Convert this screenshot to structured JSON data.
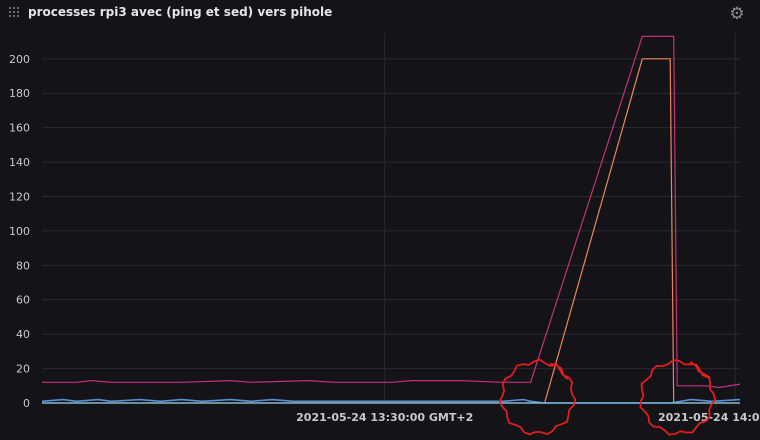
{
  "panel": {
    "title": "processes rpi3 avec (ping et sed) vers pihole",
    "settings_icon": "gear-icon",
    "drag_icon": "drag-handle-icon"
  },
  "colors": {
    "background": "#141318",
    "grid": "#2a2a31",
    "series_1": "#c2327a",
    "series_2": "#e8875a",
    "series_3": "#5b8fd6",
    "series_4": "#7ec8e3",
    "annotation": "#e01e1e"
  },
  "chart_data": {
    "type": "line",
    "title": "processes rpi3 avec (ping et sed) vers pihole",
    "xlabel": "",
    "ylabel": "",
    "ylim": [
      0,
      215
    ],
    "y_ticks": [
      0,
      20,
      40,
      60,
      80,
      100,
      120,
      140,
      160,
      180,
      200
    ],
    "x_tick_labels": [
      "2021-05-24 13:30:00 GMT+2",
      "2021-05-24 14:0"
    ],
    "grid": true,
    "legend": "none",
    "series": [
      {
        "color": "#c2327a",
        "points": [
          [
            0.0,
            12
          ],
          [
            0.05,
            12
          ],
          [
            0.07,
            13
          ],
          [
            0.1,
            12
          ],
          [
            0.2,
            12
          ],
          [
            0.27,
            13
          ],
          [
            0.3,
            12
          ],
          [
            0.38,
            13
          ],
          [
            0.42,
            12
          ],
          [
            0.5,
            12
          ],
          [
            0.53,
            13
          ],
          [
            0.6,
            13
          ],
          [
            0.66,
            12
          ],
          [
            0.68,
            12
          ],
          [
            0.7,
            12
          ],
          [
            0.86,
            213
          ],
          [
            0.905,
            213
          ],
          [
            0.91,
            10
          ],
          [
            0.95,
            10
          ],
          [
            0.97,
            9
          ],
          [
            1.0,
            11
          ]
        ]
      },
      {
        "color": "#e8875a",
        "points": [
          [
            0.0,
            0
          ],
          [
            0.72,
            0
          ],
          [
            0.86,
            200
          ],
          [
            0.9,
            200
          ],
          [
            0.905,
            0
          ],
          [
            1.0,
            0
          ]
        ]
      },
      {
        "color": "#5b8fd6",
        "points": [
          [
            0.0,
            1
          ],
          [
            0.03,
            2
          ],
          [
            0.05,
            1
          ],
          [
            0.08,
            2
          ],
          [
            0.1,
            1
          ],
          [
            0.14,
            2
          ],
          [
            0.17,
            1
          ],
          [
            0.2,
            2
          ],
          [
            0.23,
            1
          ],
          [
            0.27,
            2
          ],
          [
            0.3,
            1
          ],
          [
            0.33,
            2
          ],
          [
            0.36,
            1
          ],
          [
            0.4,
            1
          ],
          [
            0.5,
            1
          ],
          [
            0.6,
            1
          ],
          [
            0.66,
            1
          ],
          [
            0.69,
            2
          ],
          [
            0.7,
            1
          ],
          [
            0.72,
            0
          ],
          [
            0.9,
            0
          ],
          [
            0.93,
            2
          ],
          [
            0.96,
            1
          ],
          [
            1.0,
            2
          ]
        ]
      },
      {
        "color": "#7ec8e3",
        "points": [
          [
            0.0,
            0
          ],
          [
            1.0,
            0
          ]
        ]
      }
    ],
    "annotations": [
      {
        "type": "hand-drawn-circle",
        "color": "#e01e1e",
        "around_x": 0.71,
        "around_y": 2
      },
      {
        "type": "hand-drawn-circle",
        "color": "#e01e1e",
        "around_x": 0.91,
        "around_y": 2
      }
    ]
  }
}
